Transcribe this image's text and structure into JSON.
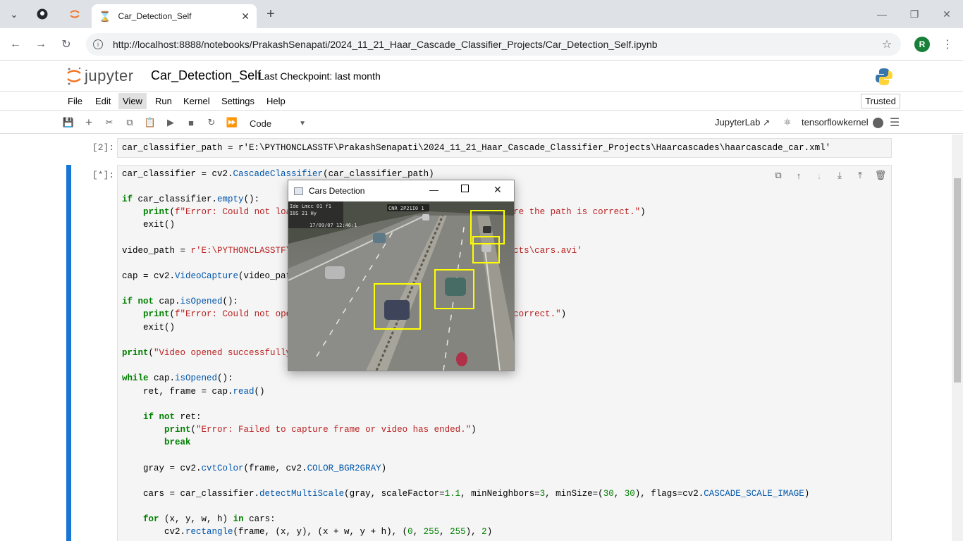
{
  "browser": {
    "tab_title": "Car_Detection_Self",
    "url": "http://localhost:8888/notebooks/PrakashSenapati/2024_11_21_Haar_Cascade_Classifier_Projects/Car_Detection_Self.ipynb",
    "avatar_letter": "R"
  },
  "jupyter": {
    "logo_text": "jupyter",
    "notebook_title": "Car_Detection_Self",
    "checkpoint": "Last Checkpoint: last month",
    "menu": [
      "File",
      "Edit",
      "View",
      "Run",
      "Kernel",
      "Settings",
      "Help"
    ],
    "trusted": "Trusted",
    "cell_type": "Code",
    "jupyterlab_link": "JupyterLab",
    "kernel": "tensorflowkernel"
  },
  "cells": {
    "c1_prompt": "[2]:",
    "c1_code": "car_classifier_path = r'E:\\PYTHONCLASSTF\\PrakashSenapati\\2024_11_21_Haar_Cascade_Classifier_Projects\\Haarcascades\\haarcascade_car.xml'",
    "c2_prompt": "[*]:"
  },
  "cv_window": {
    "title": "Cars Detection",
    "overlay_line1": "Ide Lmcc 01 f1",
    "overlay_line2": "I0S  21 Hy",
    "overlay_line3": "17/09/07 12:46:1",
    "overlay_right": "CNR 2P21I0 1"
  }
}
